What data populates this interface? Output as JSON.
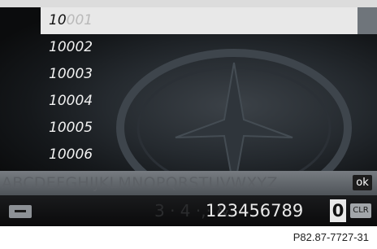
{
  "results": {
    "items": [
      {
        "label_dark": "10",
        "label_fade": "001"
      },
      {
        "label": "10002"
      },
      {
        "label": "10003"
      },
      {
        "label": "10004"
      },
      {
        "label": "10005"
      },
      {
        "label": "10006"
      }
    ]
  },
  "keyboard": {
    "letters": "ABCDEFGHIJKLMNOPQRSTUVWXYZ",
    "ok_label": "ok",
    "faint_chars": "3 · 4 ·,· &",
    "digits": "123456789",
    "selected_digit": "0",
    "clr_label": "CLR"
  },
  "caption": "P82.87-7727-31"
}
